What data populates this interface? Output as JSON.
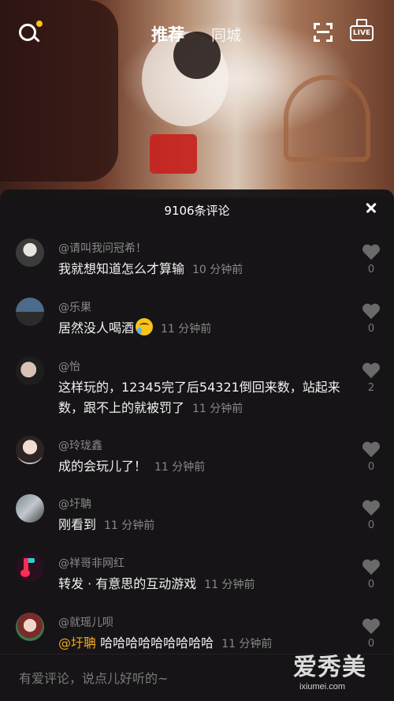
{
  "nav": {
    "tab_recommend": "推荐",
    "tab_local": "同城",
    "live_label": "LIVE"
  },
  "colors": {
    "accent_dot": "#f5c518",
    "mention": "#f0a81f",
    "sheet_bg": "#161416"
  },
  "comments_panel": {
    "title": "9106条评论",
    "comments": [
      {
        "username": "@请叫我问冠希！",
        "text": "我就想知道怎么才算输",
        "time": "10 分钟前",
        "likes": "0",
        "avatar": "avatar-photo-dark"
      },
      {
        "username": "@乐果",
        "text": "居然没人喝酒",
        "emoji": "crying-laughing-emoji",
        "time": "11 分钟前",
        "likes": "0",
        "avatar": "avatar-photo-figure"
      },
      {
        "username": "@怡",
        "text": "这样玩的，12345完了后54321倒回来数，站起来数，跟不上的就被罚了",
        "time": "11 分钟前",
        "likes": "2",
        "avatar": "avatar-photo-girl"
      },
      {
        "username": "@玲珑鑫",
        "text": "成的会玩儿了！",
        "time": "11 分钟前",
        "likes": "0",
        "avatar": "avatar-photo-face"
      },
      {
        "username": "@圩聃",
        "text": "刚看到",
        "time": "11 分钟前",
        "likes": "0",
        "avatar": "avatar-photo-landscape"
      },
      {
        "username": "@祥哥非网红",
        "text": "转发 · 有意思的互动游戏",
        "time": "11 分钟前",
        "likes": "0",
        "avatar": "avatar-music-note"
      },
      {
        "username": "@就瑶儿呗",
        "mention": "@圩聃",
        "text": " 哈哈哈哈哈哈哈哈哈",
        "time": "11 分钟前",
        "likes": "0",
        "avatar": "avatar-photo-woman"
      }
    ]
  },
  "input": {
    "placeholder": "有爱评论，说点儿好听的~"
  },
  "watermark": {
    "main": "爱秀美",
    "sub": "ixiumei.com"
  }
}
